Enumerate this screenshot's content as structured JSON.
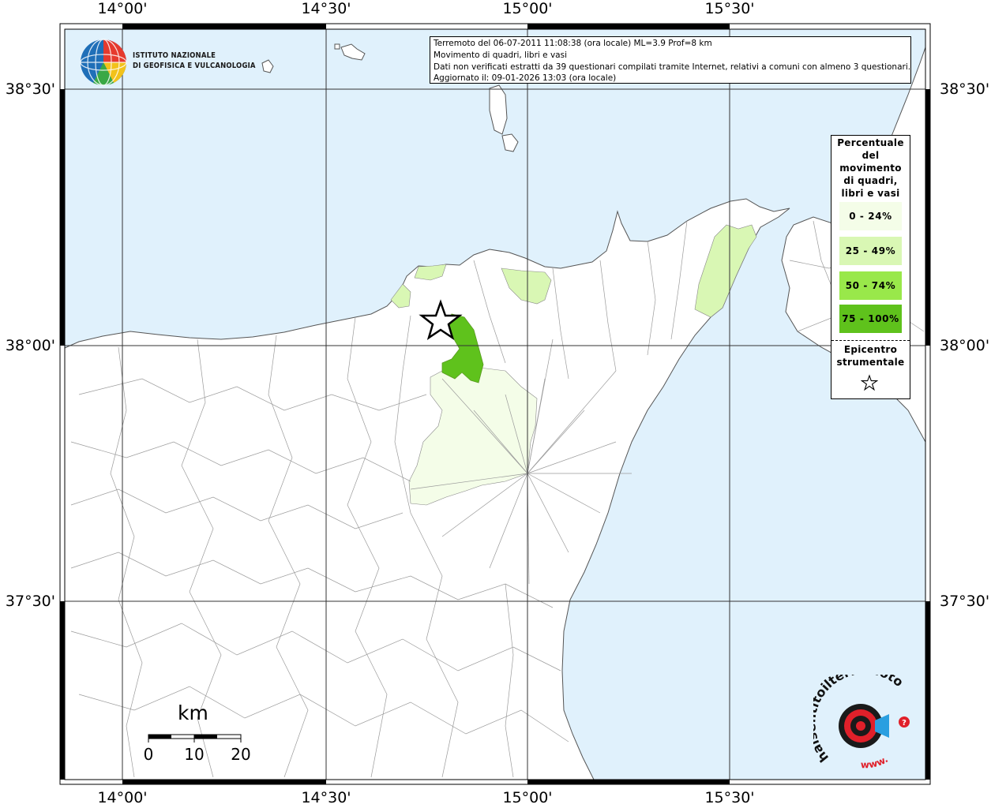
{
  "map": {
    "lon_labels": [
      "14°00'",
      "14°30'",
      "15°00'",
      "15°30'"
    ],
    "lat_labels": [
      "38°30'",
      "38°00'",
      "37°30'"
    ]
  },
  "info": {
    "line1": "Terremoto del 06-07-2011 11:08:38 (ora locale) ML=3.9 Prof=8 km",
    "line2": "Movimento di quadri, libri e vasi",
    "line3": "Dati non verificati estratti da 39 questionari compilati tramite Internet, relativi a comuni con almeno 3 questionari.",
    "line4": "Aggiornato il: 09-01-2026 13:03 (ora locale)"
  },
  "institute": {
    "line1": "ISTITUTO NAZIONALE",
    "line2": "DI GEOFISICA E VULCANOLOGIA"
  },
  "legend": {
    "title": [
      "Percentuale",
      "del",
      "movimento",
      "di quadri,",
      "libri e vasi"
    ],
    "classes": [
      {
        "label": "0 - 24%",
        "color": "#f4fde8"
      },
      {
        "label": "25 - 49%",
        "color": "#d9f7b4"
      },
      {
        "label": "50 - 74%",
        "color": "#99e84a"
      },
      {
        "label": "75 - 100%",
        "color": "#5fc21c"
      }
    ],
    "epicenter_label": [
      "Epicentro",
      "strumentale"
    ]
  },
  "scale": {
    "unit": "km",
    "ticks": [
      "0",
      "10",
      "20"
    ]
  },
  "logo": {
    "text": "haisentitoilterremoto.it",
    "www": "www."
  },
  "colors": {
    "sea": "#e0f1fc",
    "land": "#ffffff",
    "class_0_24": "#f4fde8",
    "class_25_49": "#d9f7b4",
    "class_75_100": "#5fc21c"
  }
}
